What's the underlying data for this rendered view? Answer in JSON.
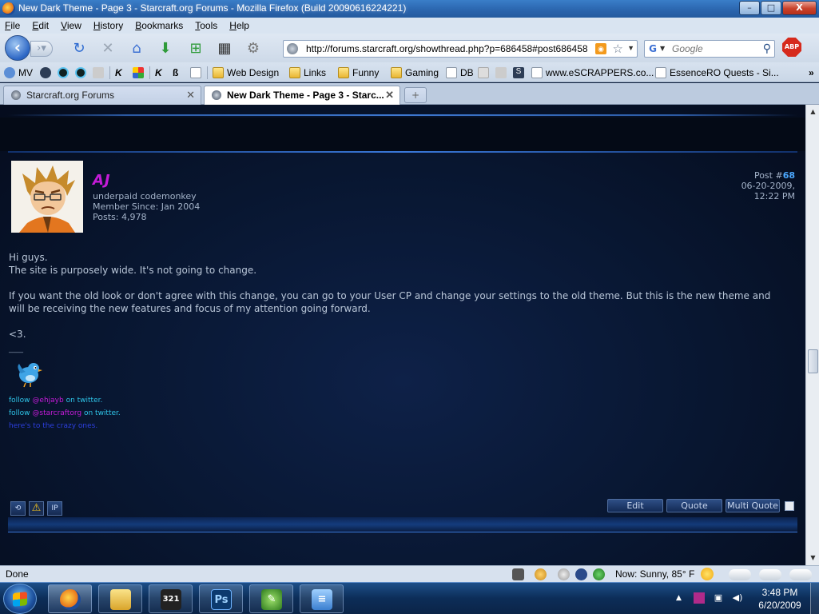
{
  "window": {
    "title": "New Dark Theme - Page 3 - Starcraft.org Forums - Mozilla Firefox (Build 20090616224221)",
    "minimize": "–",
    "maximize": "□",
    "close": "X"
  },
  "menu": [
    "File",
    "Edit",
    "View",
    "History",
    "Bookmarks",
    "Tools",
    "Help"
  ],
  "navigation": {
    "url": "http://forums.starcraft.org/showthread.php?p=686458#post686458",
    "search_placeholder": "Google",
    "abp_label": "ABP"
  },
  "bookmarks": {
    "mv": "MV",
    "web_design": "Web Design",
    "links": "Links",
    "funny": "Funny",
    "gaming": "Gaming",
    "db": "DB",
    "escrappers": "www.eSCRAPPERS.co...",
    "essencero": "EssenceRO Quests - Si...",
    "overflow": "»"
  },
  "tabs": [
    {
      "label": "Starcraft.org Forums"
    },
    {
      "label": "New Dark Theme - Page 3 - Starc..."
    }
  ],
  "new_tab": "+",
  "post": {
    "username": "AJ",
    "user_title": "underpaid codemonkey",
    "member_since": "Member Since: Jan 2004",
    "posts": "Posts: 4,978",
    "post_label": "Post #",
    "post_number": "68",
    "date": "06-20-2009,",
    "time": "12:22 PM",
    "paragraphs": [
      "Hi guys.",
      "The site is purposely wide. It's not going to change.",
      "If you want the old look or don't agree with this change, you can go to your User CP and change your settings to the old theme. But this is the new theme and will be receiving the new features and focus of my attention going forward.",
      "<3."
    ],
    "sig_divider": "____",
    "sig_follow1_pre": "follow ",
    "sig_follow1_link": "@ehjayb",
    "sig_follow1_post": " on twitter.",
    "sig_follow2_pre": "follow ",
    "sig_follow2_link": "@starcraftorg",
    "sig_follow2_post": " on twitter.",
    "sig_crazy": "here's to the crazy ones.",
    "ip_label": "IP",
    "buttons": {
      "edit": "Edit",
      "quote": "Quote",
      "multiquote": "Multi Quote"
    }
  },
  "status": {
    "text": "Done",
    "weather": "Now: Sunny, 85° F"
  },
  "taskbar": {
    "time": "3:48 PM",
    "date": "6/20/2009",
    "apps": [
      "firefox",
      "windows-explorer",
      "media-player-classic",
      "photoshop",
      "fl-studio",
      "notepad"
    ],
    "photoshop_label": "Ps"
  }
}
